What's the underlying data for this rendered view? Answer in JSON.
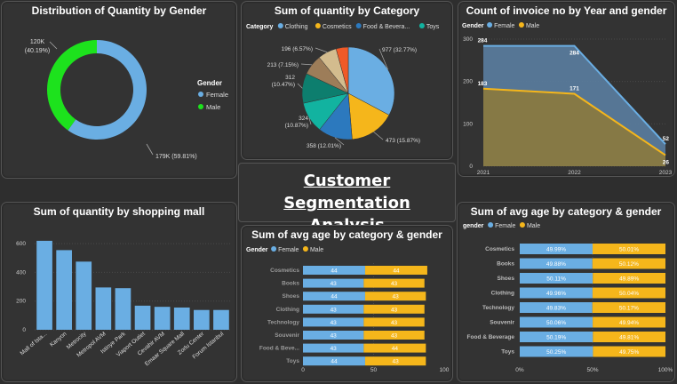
{
  "colors": {
    "female": "#6aaee3",
    "male": "#f5b61b",
    "green": "#1de21d",
    "bar": "#6aaee3",
    "grid": "#4a4a4a",
    "muted": "#9a9a9a"
  },
  "page_title_line1": "Customer Segmentation",
  "page_title_line2": "Analysis",
  "chart_data": [
    {
      "type": "donut",
      "title": "Distribution of Quantity by Gender",
      "legend_title": "Gender",
      "categories": [
        "Female",
        "Male"
      ],
      "values": [
        179,
        120
      ],
      "labels": [
        "179K (59.81%)",
        "120K (40.19%)"
      ]
    },
    {
      "type": "pie",
      "title": "Sum of quantity by Category",
      "legend_title": "Category",
      "legend": [
        "Clothing",
        "Cosmetics",
        "Food & Bevera...",
        "Toys"
      ],
      "categories": [
        "Clothing",
        "Cosmetics",
        "Food & Beverage",
        "Toys",
        "Technology",
        "Shoes",
        "Books",
        "Souvenir"
      ],
      "values": [
        977,
        473,
        358,
        324,
        312,
        213,
        196,
        127
      ],
      "labels": [
        "977 (32.77%)",
        "473 (15.87%)",
        "358 (12.01%)",
        "324 (10.87%)",
        "312 (10.47%)",
        "213 (7.15%)",
        "196 (6.57%)",
        ""
      ],
      "slice_colors": [
        "#6aaee3",
        "#f5b61b",
        "#2c79be",
        "#12b3a0",
        "#0d7e6e",
        "#9d7d59",
        "#d3bc8e",
        "#f05a28"
      ]
    },
    {
      "type": "area",
      "title": "Count of invoice no by Year and gender",
      "legend_title": "Gender",
      "x": [
        "2021",
        "2022",
        "2023"
      ],
      "ylim": [
        0,
        300
      ],
      "yticks": [
        0,
        100,
        200,
        300
      ],
      "series": [
        {
          "name": "Female",
          "values": [
            284,
            284,
            52
          ]
        },
        {
          "name": "Male",
          "values": [
            183,
            171,
            26
          ]
        }
      ]
    },
    {
      "type": "bar",
      "title": "Sum of quantity by shopping mall",
      "categories": [
        "Mall of Ista...",
        "Kanyon",
        "Metrocity",
        "Metropol AVM",
        "Istinye Park",
        "Viaport Outlet",
        "Cevahir AVM",
        "Emaar Square Mall",
        "Zorlu Center",
        "Forum Istanbul"
      ],
      "values": [
        620,
        555,
        475,
        295,
        290,
        168,
        160,
        155,
        138,
        138
      ],
      "ylim": [
        0,
        700
      ],
      "yticks": [
        0,
        200,
        400,
        600
      ]
    },
    {
      "type": "bar",
      "title": "Sum of avg age by category & gender",
      "legend_title": "Gender",
      "categories": [
        "Cosmetics",
        "Books",
        "Shoes",
        "Clothing",
        "Technology",
        "Souvenir",
        "Food & Beve...",
        "Toys"
      ],
      "series": [
        {
          "name": "Female",
          "values": [
            44,
            43,
            44,
            43,
            43,
            43,
            43,
            44
          ]
        },
        {
          "name": "Male",
          "values": [
            44,
            43,
            43,
            43,
            43,
            43,
            44,
            43
          ]
        }
      ],
      "xlim": [
        0,
        100
      ],
      "xticks": [
        "0",
        "50",
        "100"
      ]
    },
    {
      "type": "bar",
      "title": "Sum of avg age by category & gender",
      "legend_title": "gender",
      "categories": [
        "Cosmetics",
        "Books",
        "Shoes",
        "Clothing",
        "Technology",
        "Souvenir",
        "Food & Beverage",
        "Toys"
      ],
      "series": [
        {
          "name": "Female",
          "values": [
            49.99,
            49.88,
            50.11,
            49.96,
            49.83,
            50.06,
            50.19,
            50.25
          ],
          "labels": [
            "49.99%",
            "49.88%",
            "50.11%",
            "49.96%",
            "49.83%",
            "50.06%",
            "50.19%",
            "50.25%"
          ]
        },
        {
          "name": "Male",
          "values": [
            50.01,
            50.12,
            49.89,
            50.04,
            50.17,
            49.94,
            49.81,
            49.75
          ],
          "labels": [
            "50.01%",
            "50.12%",
            "49.89%",
            "50.04%",
            "50.17%",
            "49.94%",
            "49.81%",
            "49.75%"
          ]
        }
      ],
      "xticks": [
        "0%",
        "50%",
        "100%"
      ]
    }
  ]
}
